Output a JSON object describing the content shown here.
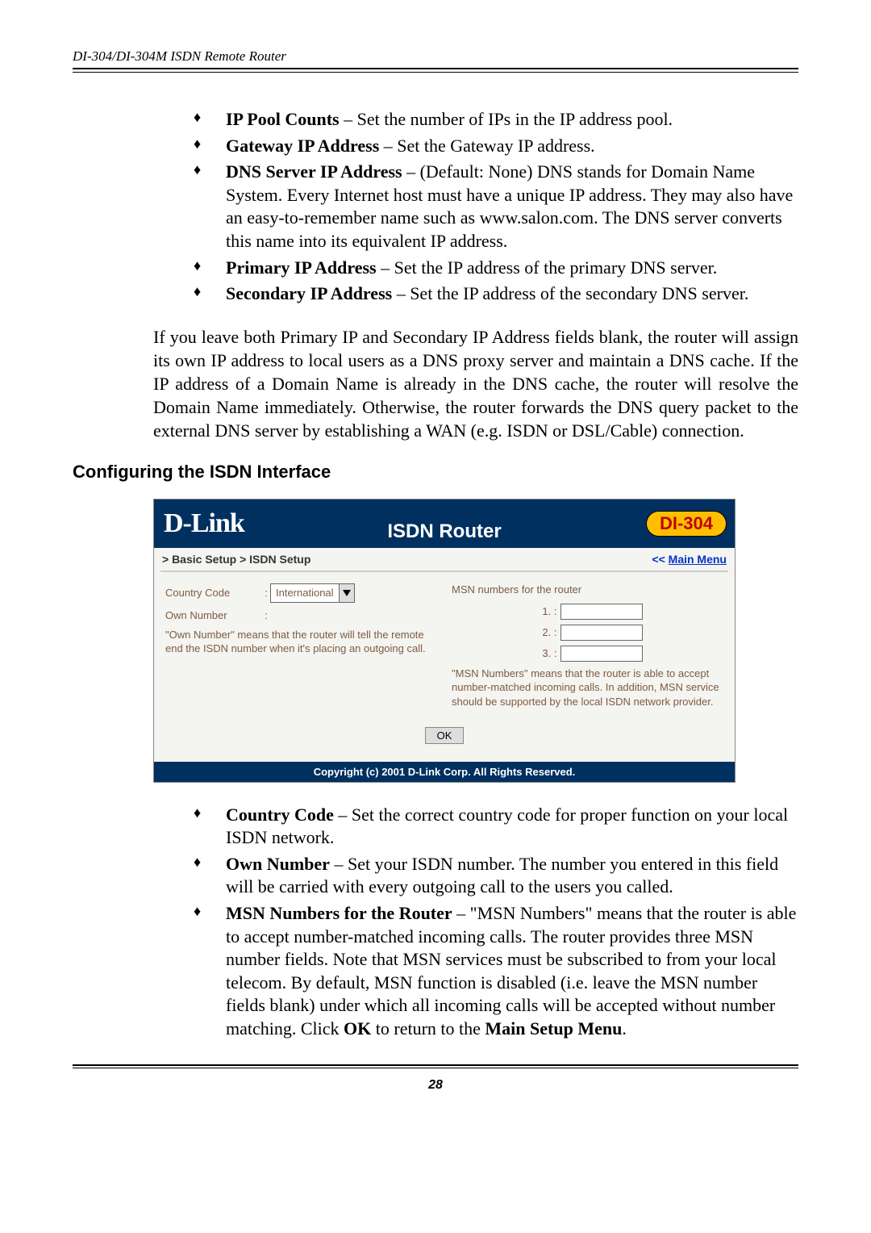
{
  "running_head": "DI-304/DI-304M ISDN Remote Router",
  "top_bullets": [
    {
      "label": "IP Pool Counts",
      "text": " – Set the number of IPs in the IP address pool."
    },
    {
      "label": "Gateway IP Address",
      "text": " – Set the Gateway IP address."
    },
    {
      "label": "DNS Server IP Address",
      "text": " – (Default: None) DNS stands for Domain Name System. Every Internet host must have a unique IP address. They may also have an easy-to-remember name such as www.salon.com. The DNS server converts this name into its equivalent IP address."
    },
    {
      "label": "Primary IP Address",
      "text": " – Set the IP address of the primary DNS server."
    },
    {
      "label": "Secondary IP Address",
      "text": " – Set the IP address of the secondary DNS server."
    }
  ],
  "body_para": "If you leave both Primary IP and Secondary IP Address fields blank, the router will assign its own IP address to local users as a DNS proxy server and maintain a DNS cache. If the IP address of a Domain Name is already in the DNS cache, the router will resolve the Domain Name immediately. Otherwise, the router forwards the DNS query packet to the external DNS server by establishing a WAN (e.g. ISDN or DSL/Cable) connection.",
  "section_heading": "Configuring the ISDN Interface",
  "panel": {
    "logo": "D-Link",
    "title": "ISDN Router",
    "badge": "DI-304",
    "crumb": "> Basic Setup > ISDN Setup",
    "main_menu_pref": "<< ",
    "main_menu": "Main Menu",
    "country_code_label": "Country Code",
    "country_code_value": "International",
    "own_number_label": "Own Number",
    "own_number_value": "",
    "left_note": "\"Own Number\" means that the router will tell the remote end the ISDN number when it's placing an outgoing call.",
    "msn_header": "MSN numbers for the router",
    "msn_rows": [
      "1. :",
      "2. :",
      "3. :"
    ],
    "right_note": "\"MSN Numbers\" means that the router is able to accept number-matched incoming calls. In addition, MSN service should be supported by the local ISDN network provider.",
    "ok": "OK",
    "footer": "Copyright (c) 2001 D-Link Corp. All Rights Reserved."
  },
  "bottom_bullets": [
    {
      "label": "Country Code",
      "text": " – Set the correct country code for proper function on your local ISDN network."
    },
    {
      "label": "Own Number",
      "text": " – Set your ISDN number. The number you entered in this field will be carried with every outgoing call to the users you called."
    },
    {
      "label": "MSN Numbers for the Router",
      "text": " – \"MSN Numbers\" means that the router is able to accept number-matched incoming calls. The router provides three MSN number fields. Note that MSN services must be subscribed to from your local telecom. By default, MSN function is disabled (i.e. leave the MSN number fields blank) under which all incoming calls will be accepted without number matching. Click ",
      "bold2": "OK",
      "text2": " to return to the ",
      "bold3": "Main Setup Menu",
      "text3": "."
    }
  ],
  "page_no": "28"
}
